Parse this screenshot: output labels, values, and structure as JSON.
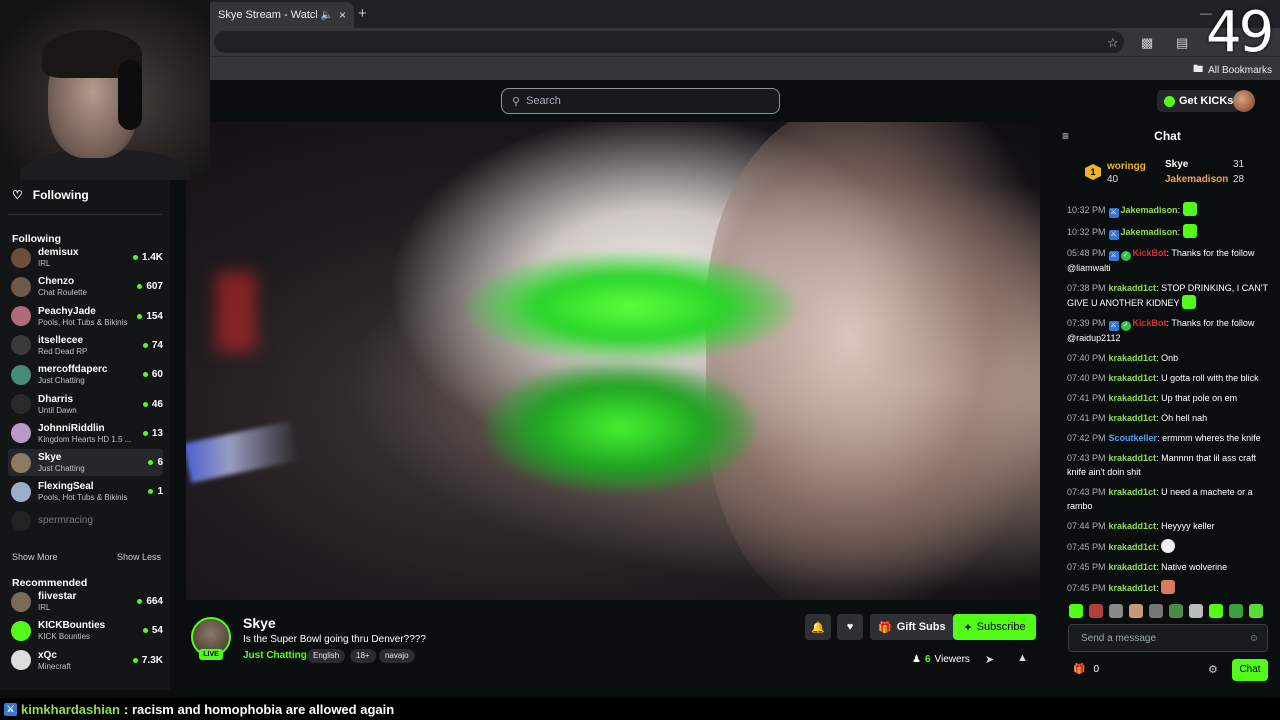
{
  "browser": {
    "tab_title": "Skye Stream - Watch Live o",
    "tab_close": "×",
    "new_tab": "+",
    "bookmarks_label": "All Bookmarks"
  },
  "overlay": {
    "clock": "49"
  },
  "header": {
    "search_placeholder": "Search",
    "get_kicks_label": "Get KICKs"
  },
  "sidebar": {
    "following_button": "Following",
    "following_heading": "Following",
    "following": [
      {
        "name": "demisux",
        "category": "IRL",
        "viewers": "1.4K",
        "live": true,
        "color": "#6b4e3d"
      },
      {
        "name": "Chenzo",
        "category": "Chat Roulette",
        "viewers": "607",
        "live": true,
        "color": "#6d5a4a"
      },
      {
        "name": "PeachyJade",
        "category": "Pools, Hot Tubs & Bikinis",
        "viewers": "154",
        "live": true,
        "color": "#b06a7a"
      },
      {
        "name": "itsellecee",
        "category": "Red Dead RP",
        "viewers": "74",
        "live": true,
        "color": "#3a3a3a"
      },
      {
        "name": "mercoffdaperc",
        "category": "Just Chatting",
        "viewers": "60",
        "live": true,
        "color": "#4a8a7a"
      },
      {
        "name": "Dharris",
        "category": "Until Dawn",
        "viewers": "46",
        "live": true,
        "color": "#2a2a2a"
      },
      {
        "name": "JohnniRiddlin",
        "category": "Kingdom Hearts HD 1.5 ...",
        "viewers": "13",
        "live": true,
        "color": "#b89ac8"
      },
      {
        "name": "Skye",
        "category": "Just Chatting",
        "viewers": "6",
        "live": true,
        "color": "#8a7a66"
      },
      {
        "name": "FlexingSeal",
        "category": "Pools, Hot Tubs & Bikinis",
        "viewers": "1",
        "live": true,
        "color": "#9ab0c8"
      },
      {
        "name": "spermracing",
        "category": "",
        "viewers": "",
        "live": false,
        "color": "#222"
      }
    ],
    "show_more": "Show More",
    "show_less": "Show Less",
    "recommended_heading": "Recommended",
    "recommended": [
      {
        "name": "fiivestar",
        "category": "IRL",
        "viewers": "664",
        "color": "#7a6a5a"
      },
      {
        "name": "KICKBounties",
        "category": "KICK Bounties",
        "viewers": "54",
        "color": "#53fc18"
      },
      {
        "name": "xQc",
        "category": "Minecraft",
        "viewers": "7.3K",
        "color": "#dddddd"
      }
    ]
  },
  "stream": {
    "streamer": "Skye",
    "live_badge": "LIVE",
    "title": "Is the Super Bowl going thru Denver????",
    "category": "Just Chatting",
    "tags": [
      "English",
      "18+",
      "navajo"
    ],
    "gift_label": "Gift Subs",
    "subscribe_label": "Subscribe",
    "viewer_count": "6",
    "viewer_label": "Viewers"
  },
  "chat": {
    "title": "Chat",
    "leaderboard": [
      {
        "rank": "1",
        "name": "woringg",
        "count": "40"
      },
      {
        "name": "Skye",
        "count": "31"
      },
      {
        "name": "Jakemadison",
        "count": "28"
      }
    ],
    "messages": [
      {
        "time": "10:32 PM",
        "user": "Jakemadison",
        "style": "",
        "badges": [
          "mod"
        ],
        "text": "",
        "emote": "g"
      },
      {
        "time": "10:32 PM",
        "user": "Jakemadison",
        "style": "",
        "badges": [
          "mod"
        ],
        "text": "",
        "emote": "g"
      },
      {
        "time": "05:48 PM",
        "user": "KickBot",
        "style": "red",
        "badges": [
          "mod",
          "ver"
        ],
        "text": "Thanks for the follow @liamwalti",
        "emote": ""
      },
      {
        "time": "07:38 PM",
        "user": "krakadd1ct",
        "style": "",
        "badges": [],
        "text": "STOP DRINKING, I CAN'T GIVE U ANOTHER KIDNEY",
        "emote": "g"
      },
      {
        "time": "07:39 PM",
        "user": "KickBot",
        "style": "red",
        "badges": [
          "mod",
          "ver"
        ],
        "text": "Thanks for the follow @raidup2112",
        "emote": ""
      },
      {
        "time": "07:40 PM",
        "user": "krakadd1ct",
        "style": "",
        "badges": [],
        "text": "Onb",
        "emote": ""
      },
      {
        "time": "07:40 PM",
        "user": "krakadd1ct",
        "style": "",
        "badges": [],
        "text": "U gotta roll with the blick",
        "emote": ""
      },
      {
        "time": "07:41 PM",
        "user": "krakadd1ct",
        "style": "",
        "badges": [],
        "text": "Up that pole on em",
        "emote": ""
      },
      {
        "time": "07:41 PM",
        "user": "krakadd1ct",
        "style": "",
        "badges": [],
        "text": "Oh hell nah",
        "emote": ""
      },
      {
        "time": "07:42 PM",
        "user": "Scoutkeller",
        "style": "blue",
        "badges": [],
        "text": "ermmm wheres the knife",
        "emote": ""
      },
      {
        "time": "07:43 PM",
        "user": "krakadd1ct",
        "style": "",
        "badges": [],
        "text": "Mannnn that lil ass craft knife ain't doin shit",
        "emote": ""
      },
      {
        "time": "07:43 PM",
        "user": "krakadd1ct",
        "style": "",
        "badges": [],
        "text": "U need a machete or a rambo",
        "emote": ""
      },
      {
        "time": "07:44 PM",
        "user": "krakadd1ct",
        "style": "",
        "badges": [],
        "text": "Heyyyy keller",
        "emote": ""
      },
      {
        "time": "07:45 PM",
        "user": "krakadd1ct",
        "style": "",
        "badges": [],
        "text": "",
        "emote": "w"
      },
      {
        "time": "07:45 PM",
        "user": "krakadd1ct",
        "style": "",
        "badges": [],
        "text": "Native wolverine",
        "emote": ""
      },
      {
        "time": "07:45 PM",
        "user": "krakadd1ct",
        "style": "",
        "badges": [],
        "text": "",
        "emote": "p"
      }
    ],
    "input_placeholder": "Send a message",
    "kicks_count": "0",
    "send_label": "Chat"
  },
  "banner": {
    "user": "kimkhardashian",
    "text": ": racism and homophobia are allowed again"
  },
  "colors": {
    "accent": "#53fc18",
    "bg": "#0b0e0f",
    "sidebar_bg": "#141517"
  }
}
